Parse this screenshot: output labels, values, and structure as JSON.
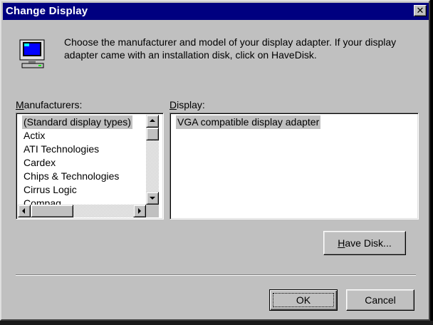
{
  "window": {
    "title": "Change Display",
    "close_label": "✕"
  },
  "intro": {
    "icon": "monitor-icon",
    "text": "Choose the manufacturer and model of your display adapter.  If your display adapter came with an installation disk, click on HaveDisk."
  },
  "manufacturers": {
    "label_accel": "M",
    "label_rest": "anufacturers:",
    "selected_index": 0,
    "items": [
      "(Standard display types)",
      "Actix",
      "ATI Technologies",
      "Cardex",
      "Chips & Technologies",
      "Cirrus Logic",
      "Compaq"
    ]
  },
  "display": {
    "label_accel": "D",
    "label_rest": "isplay:",
    "items": [
      "VGA compatible display adapter"
    ]
  },
  "buttons": {
    "have_disk_accel": "H",
    "have_disk_rest": "ave Disk...",
    "ok": "OK",
    "cancel": "Cancel"
  },
  "colors": {
    "title_bar": "#000080",
    "face": "#c0c0c0",
    "selection": "#c0c0c0"
  }
}
